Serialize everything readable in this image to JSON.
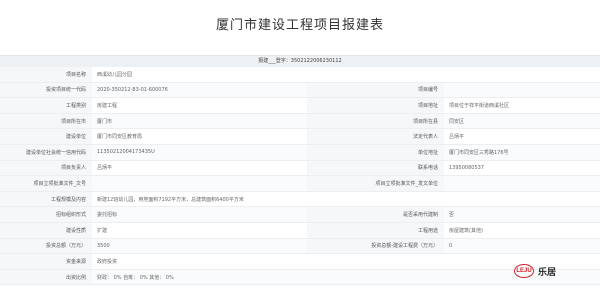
{
  "title": "厦门市建设工程项目报建表",
  "registration": "报建___登字：350212200623​0112",
  "rows": [
    {
      "l1": "项目名称",
      "v1": "西溪幼儿园分园",
      "l2": "",
      "v2": "",
      "full": true
    },
    {
      "l1": "投资项目统一代码",
      "v1": "2020-350212-83-01-600076",
      "l2": "项目编号",
      "v2": ""
    },
    {
      "l1": "工程类别",
      "v1": "房建工程",
      "l2": "项目地址",
      "v2": "项目位于祥平街道西溪社区"
    },
    {
      "l1": "项目所在市",
      "v1": "厦门市",
      "l2": "项目所在县",
      "v2": "同安区"
    },
    {
      "l1": "建设单位",
      "v1": "厦门市同安区教育局",
      "l2": "法定代表人",
      "v2": "吕炳平"
    },
    {
      "l1": "建设单位社会统一信用代码",
      "v1": "11350212004173435U",
      "l2": "单位地址",
      "v2": "厦门市同安区三秀路176号"
    },
    {
      "l1": "项目负责人",
      "v1": "吕炳平",
      "l2": "联系电话",
      "v2": "13950080537"
    },
    {
      "l1": "项目立项批准文件_文号",
      "v1": "",
      "l2": "项目立项批准文件_发文单位",
      "v2": ""
    },
    {
      "l1": "工程规模及内容",
      "v1": "新建12班幼儿园，用地面积7192平方米，总建筑面积6400平方米",
      "l2": "",
      "v2": "",
      "full": true
    },
    {
      "l1": "招标组织形式",
      "v1": "委托招标",
      "l2": "是否采用代建制",
      "v2": "否"
    },
    {
      "l1": "建设性质",
      "v1": "扩建",
      "l2": "工程用途",
      "v2": "房屋建筑(其他)"
    },
    {
      "l1": "投资总额（万元）",
      "v1": "3500",
      "l2": "投资总额-建设工程费（万元）",
      "v2": "0"
    },
    {
      "l1": "资金来源",
      "v1": "政府投资",
      "l2": "",
      "v2": "",
      "full": true
    },
    {
      "l1": "出资比例",
      "v1": "财政：  0%     自筹：  0%     其他：  0%",
      "l2": "",
      "v2": "",
      "full": true
    }
  ],
  "logo": {
    "mark": "LEJU",
    "text": "乐居",
    "color": "#d4232b"
  }
}
